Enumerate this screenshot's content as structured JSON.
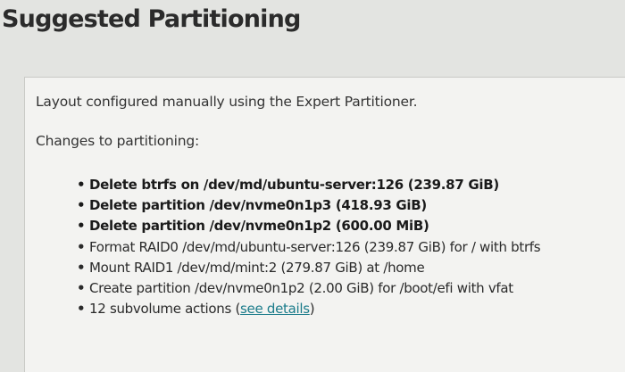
{
  "page": {
    "title": "Suggested Partitioning"
  },
  "summary": {
    "intro": "Layout configured manually using the Expert Partitioner.",
    "changes_label": "Changes to partitioning:"
  },
  "changes": [
    {
      "text": "Delete btrfs on /dev/md/ubuntu-server:126 (239.87 GiB)",
      "bold": true
    },
    {
      "text": "Delete partition /dev/nvme0n1p3 (418.93 GiB)",
      "bold": true
    },
    {
      "text": "Delete partition /dev/nvme0n1p2 (600.00 MiB)",
      "bold": true
    },
    {
      "text": "Format RAID0 /dev/md/ubuntu-server:126 (239.87 GiB) for / with btrfs",
      "bold": false
    },
    {
      "text": "Mount RAID1 /dev/md/mint:2 (279.87 GiB) at /home",
      "bold": false
    },
    {
      "text": "Create partition /dev/nvme0n1p2 (2.00 GiB) for /boot/efi with vfat",
      "bold": false
    }
  ],
  "subvolume_item": {
    "prefix": "12 subvolume actions (",
    "link_text": "see details",
    "suffix": ")"
  },
  "bullet_glyph": "•",
  "colors": {
    "background": "#e3e4e1",
    "panel": "#f3f3f1",
    "link": "#1a7b8a"
  }
}
